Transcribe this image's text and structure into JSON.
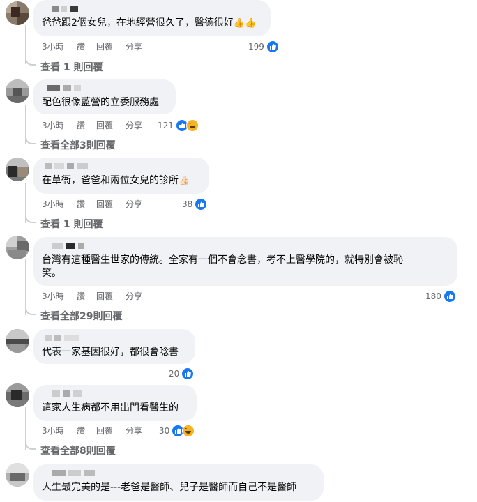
{
  "comments": [
    {
      "text": "爸爸跟2個女兒，在地經營很久了，醫德很好",
      "emoji": "👍👍",
      "time": "3小時",
      "like": "讚",
      "reply": "回覆",
      "share": "分享",
      "count": "199",
      "reactions": [
        "like-icon"
      ],
      "view_replies": "查看 1 則回覆"
    },
    {
      "text": "配色很像藍營的立委服務處",
      "time": "3小時",
      "like": "讚",
      "reply": "回覆",
      "share": "分享",
      "count": "121",
      "reactions": [
        "like-icon",
        "haha-icon"
      ],
      "view_replies": "查看全部3則回覆"
    },
    {
      "text": "在草衙，爸爸和兩位女兒的診所",
      "emoji": "👍🏻",
      "time": "3小時",
      "like": "讚",
      "reply": "回覆",
      "share": "分享",
      "count": "38",
      "reactions": [
        "like-icon"
      ],
      "view_replies": "查看 1 則回覆"
    },
    {
      "text_line1": "台灣有這種醫生世家的傳統。全家有一個不會念書，考不上醫學院的，就特別會被恥",
      "text_line2": "笑。",
      "time": "3小時",
      "like": "讚",
      "reply": "回覆",
      "share": "分享",
      "count": "180",
      "reactions": [
        "like-icon"
      ],
      "view_replies": "查看全部29則回覆"
    },
    {
      "text": "代表一家基因很好，都很會唸書",
      "count": "20",
      "reactions": [
        "like-icon"
      ]
    },
    {
      "text": "這家人生病都不用出門看醫生的",
      "time": "3小時",
      "like": "讚",
      "reply": "回覆",
      "share": "分享",
      "count": "30",
      "reactions": [
        "like-icon",
        "haha-icon"
      ],
      "view_replies": "查看全部8則回覆"
    },
    {
      "text": "人生最完美的是---老爸是醫師、兒子是醫師而自己不是醫師"
    }
  ],
  "colors": {
    "bubble": "#f0f2f5",
    "meta_text": "#65676b",
    "like_blue": "#1877f2",
    "haha_yellow": "#f7b125",
    "thread_line": "#ced0d4"
  }
}
